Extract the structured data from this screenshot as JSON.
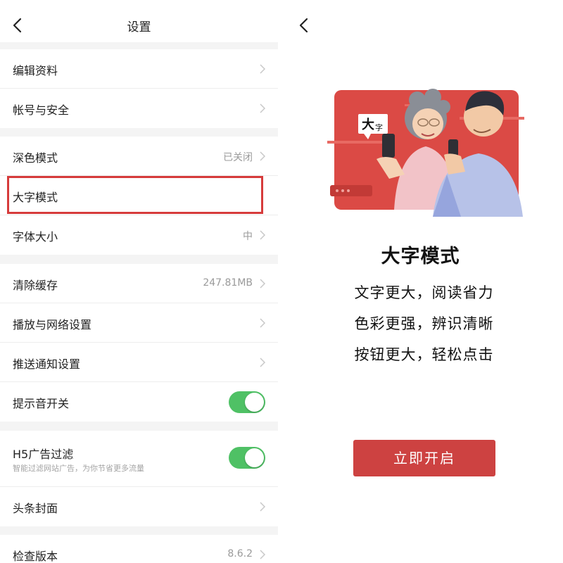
{
  "settings": {
    "title": "设置",
    "groups": [
      {
        "items": [
          {
            "label": "编辑资料"
          },
          {
            "label": "帐号与安全"
          }
        ]
      },
      {
        "items": [
          {
            "label": "深色模式",
            "value": "已关闭"
          },
          {
            "label": "大字模式"
          },
          {
            "label": "字体大小",
            "value": "中"
          }
        ]
      },
      {
        "items": [
          {
            "label": "清除缓存",
            "value": "247.81MB"
          },
          {
            "label": "播放与网络设置"
          },
          {
            "label": "推送通知设置"
          },
          {
            "label": "提示音开关",
            "toggle": true
          }
        ]
      },
      {
        "items": [
          {
            "label": "H5广告过滤",
            "sublabel": "智能过滤网站广告，为你节省更多流量",
            "toggle": true
          },
          {
            "label": "头条封面"
          }
        ]
      },
      {
        "items": [
          {
            "label": "检查版本",
            "value": "8.6.2"
          }
        ]
      }
    ],
    "highlighted_item": "大字模式"
  },
  "large_font": {
    "badge_main": "大",
    "badge_small": "字",
    "title": "大字模式",
    "features": [
      "文字更大，阅读省力",
      "色彩更强，辨识清晰",
      "按钮更大，轻松点击"
    ],
    "button_label": "立即开启"
  },
  "colors": {
    "accent_red": "#cd4241",
    "toggle_green": "#4fc165",
    "highlight_border": "#d63b3b"
  },
  "icons": {
    "back": "chevron-left-icon",
    "row_arrow": "chevron-right-icon"
  }
}
